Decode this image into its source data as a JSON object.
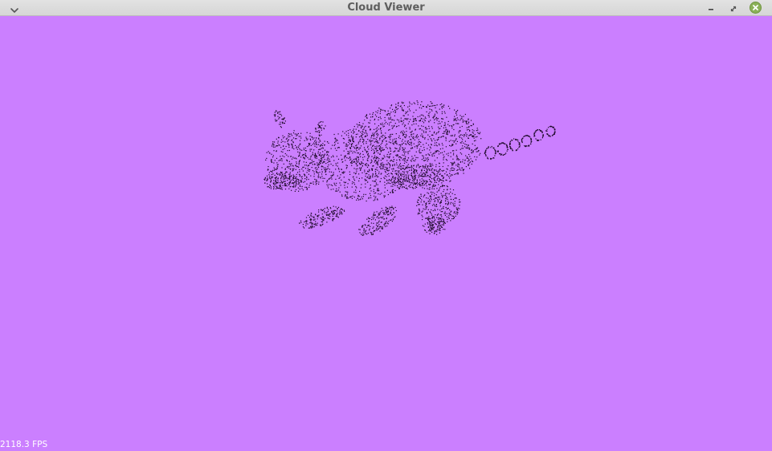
{
  "window": {
    "title": "Cloud Viewer"
  },
  "viewport": {
    "background_color": "#cb7fff",
    "point_color": "#1e0a2a",
    "fps_text": "2118.3 FPS"
  },
  "icons": {
    "menu": "chevron-down-icon",
    "minimize": "minimize-icon",
    "maximize": "maximize-icon",
    "close": "close-icon"
  },
  "colors": {
    "titlebar": "#dcdcdc",
    "title_text": "#5e5e5e",
    "close_button": "#8bb158"
  }
}
